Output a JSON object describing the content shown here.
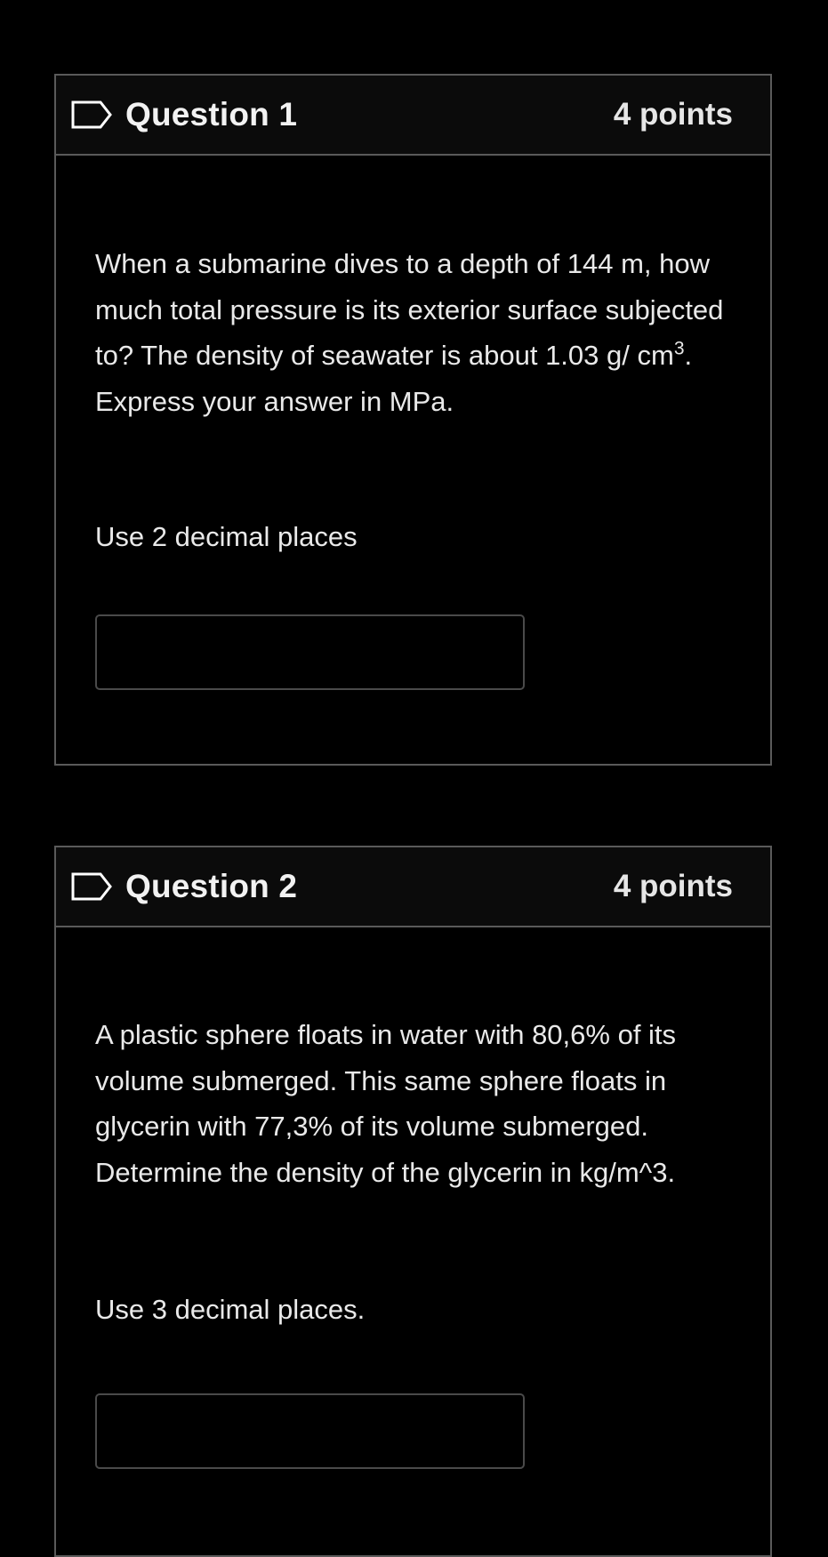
{
  "questions": [
    {
      "title": "Question 1",
      "points": "4 points",
      "text_main": "When a submarine dives to a depth of 144 m, how much total pressure is its exterior surface subjected to? The density of seawater is about 1.03 g/ cm",
      "text_sup": "3",
      "text_tail": ". Express your answer in MPa.",
      "instruction": "Use 2 decimal places",
      "answer_value": "",
      "answer_placeholder": ""
    },
    {
      "title": "Question 2",
      "points": "4 points",
      "text_main": "A plastic sphere floats in water with 80,6% of its volume submerged. This same sphere floats in glycerin with 77,3% of its volume submerged. Determine the density of the glycerin in kg/m^3.",
      "instruction": "Use 3 decimal places.",
      "answer_value": "",
      "answer_placeholder": ""
    }
  ],
  "icons": {
    "flag": "flag-outline-icon"
  },
  "colors": {
    "background": "#000000",
    "header_background": "#0b0b0b",
    "border": "#5a5a5a",
    "text": "#e9e9e9"
  }
}
